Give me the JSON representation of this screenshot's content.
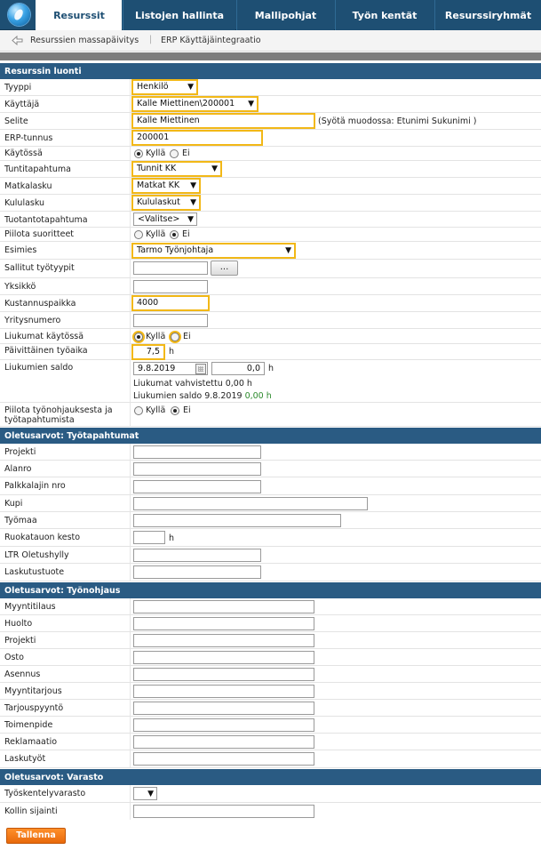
{
  "nav": {
    "tabs": [
      "Resurssit",
      "Listojen hallinta",
      "Mallipohjat",
      "Työn kentät",
      "Resurssiryhmät"
    ]
  },
  "subnav": {
    "item1": "Resurssien massapäivitys",
    "separator": "|",
    "item2": "ERP Käyttäjäintegraatio"
  },
  "sections": {
    "luonti": "Resurssin luonti",
    "tyotapahtumat": "Oletusarvot: Työtapahtumat",
    "tyonohjaus": "Oletusarvot: Työnohjaus",
    "varasto": "Oletusarvot: Varasto"
  },
  "luonti": {
    "tyyppi": {
      "label": "Tyyppi",
      "value": "Henkilö"
    },
    "kayttaja": {
      "label": "Käyttäjä",
      "value": "Kalle Miettinen\\200001"
    },
    "selite": {
      "label": "Selite",
      "value": "Kalle Miettinen",
      "hint": "(Syötä muodossa: Etunimi Sukunimi )"
    },
    "erp": {
      "label": "ERP-tunnus",
      "value": "200001"
    },
    "kaytossa": {
      "label": "Käytössä",
      "yes": "Kyllä",
      "no": "Ei",
      "selected": "Kyllä"
    },
    "tuntitapahtuma": {
      "label": "Tuntitapahtuma",
      "value": "Tunnit KK"
    },
    "matkalasku": {
      "label": "Matkalasku",
      "value": "Matkat KK"
    },
    "kululasku": {
      "label": "Kululasku",
      "value": "Kululaskut"
    },
    "tuotanto": {
      "label": "Tuotantotapahtuma",
      "value": "<Valitse>"
    },
    "piilota": {
      "label": "Piilota suoritteet",
      "yes": "Kyllä",
      "no": "Ei",
      "selected": "Ei"
    },
    "esimies": {
      "label": "Esimies",
      "value": "Tarmo Työnjohtaja"
    },
    "sallitut": {
      "label": "Sallitut työtyypit",
      "value": "",
      "button": "..."
    },
    "yksikko": {
      "label": "Yksikkö",
      "value": ""
    },
    "kustannus": {
      "label": "Kustannuspaikka",
      "value": "4000"
    },
    "ytunnus": {
      "label": "Yritysnumero",
      "value": ""
    },
    "liukumat": {
      "label": "Liukumat käytössä",
      "yes": "Kyllä",
      "no": "Ei",
      "selected": "Kyllä"
    },
    "paivittainen": {
      "label": "Päivittäinen työaika",
      "value": "7,5",
      "unit": "h"
    },
    "saldo": {
      "label": "Liukumien saldo",
      "date": "9.8.2019",
      "hours": "0,0",
      "unit": "h",
      "vahvistettu": "Liukumat vahvistettu 0,00 h",
      "saldo_text": "Liukumien saldo 9.8.2019",
      "saldo_value": "0,00 h"
    },
    "piilota_tyo": {
      "label": "Piilota työnohjauksesta ja työtapahtumista",
      "yes": "Kyllä",
      "no": "Ei",
      "selected": "Ei"
    }
  },
  "tyotapahtumat": {
    "projekti": "Projekti",
    "alanro": "Alanro",
    "palkkalaji": "Palkkalajin nro",
    "kupi": "Kupi",
    "tyomaa": "Työmaa",
    "ruokatauko": "Ruokatauon kesto",
    "ruokatauko_unit": "h",
    "ltr": "LTR Oletushylly",
    "laskutustuote": "Laskutustuote"
  },
  "tyonohjaus": {
    "labels": [
      "Myyntitilaus",
      "Huolto",
      "Projekti",
      "Osto",
      "Asennus",
      "Myyntitarjous",
      "Tarjouspyyntö",
      "Toimenpide",
      "Reklamaatio",
      "Laskutyöt"
    ]
  },
  "varasto": {
    "tyoskentely": "Työskentelyvarasto",
    "kollin": "Kollin sijainti"
  },
  "save": "Tallenna",
  "colors": {
    "nav_bg": "#1e4f73",
    "section_bg": "#2a5b83",
    "highlight": "#f2b817",
    "save_button": "#f57c1a"
  }
}
